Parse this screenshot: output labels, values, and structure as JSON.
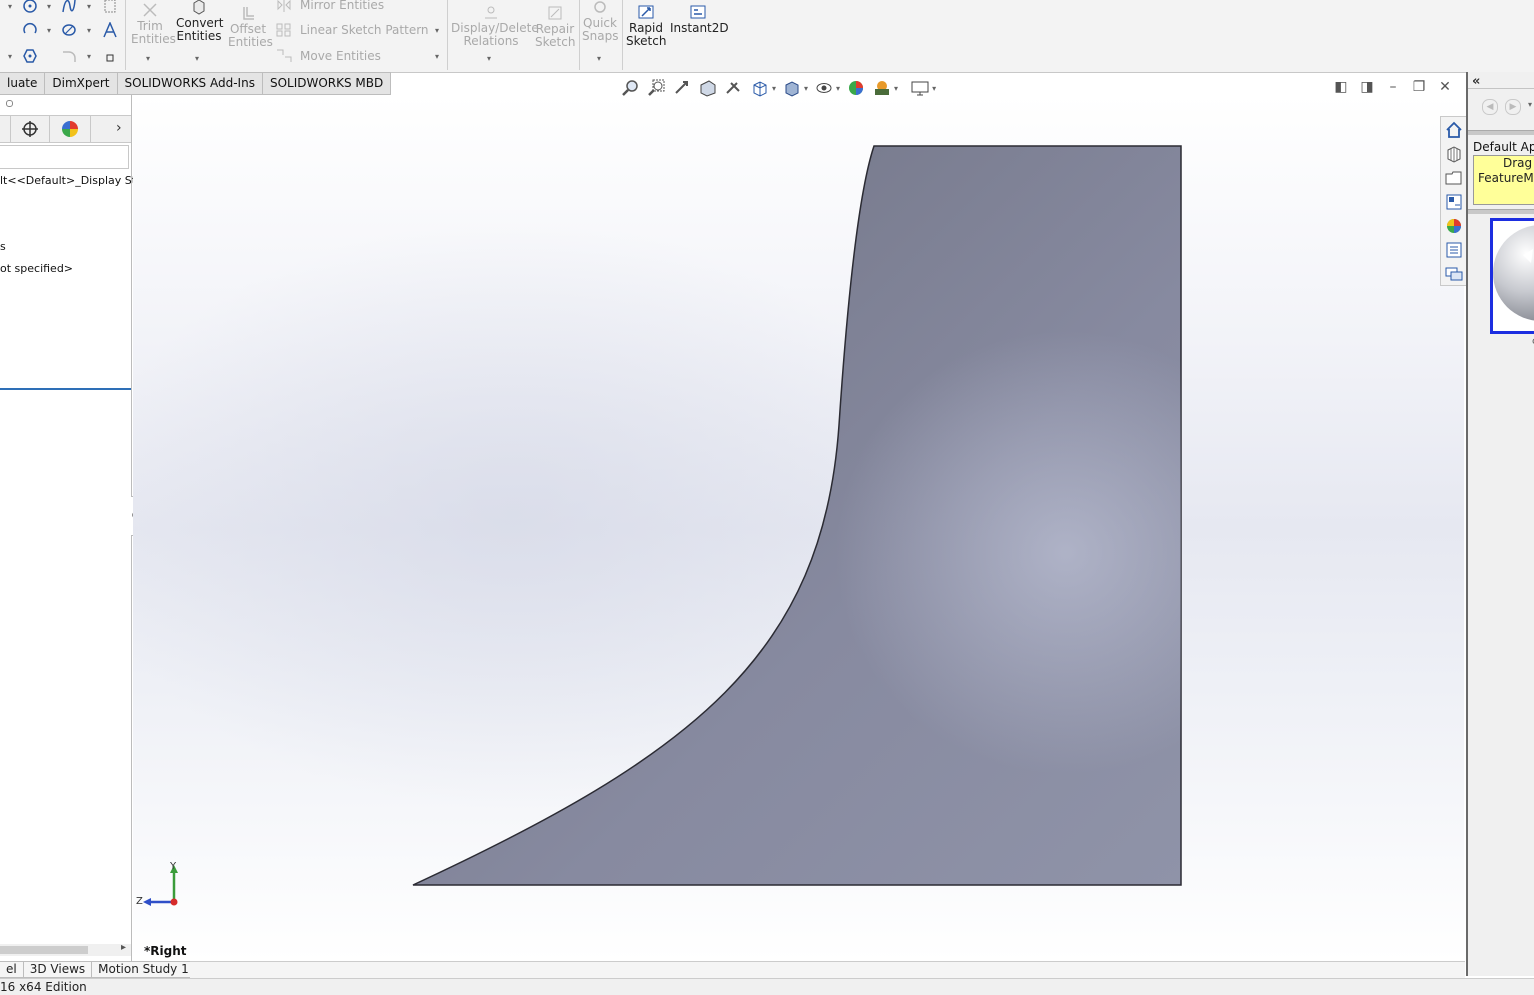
{
  "ribbon": {
    "trim": [
      "Trim",
      "Entities"
    ],
    "convert": [
      "Convert",
      "Entities"
    ],
    "offset": [
      "Offset",
      "Entities"
    ],
    "mirror": "Mirror Entities",
    "linear_pattern": "Linear Sketch Pattern",
    "move": "Move Entities",
    "display_delete": [
      "Display/Delete",
      "Relations"
    ],
    "repair": [
      "Repair",
      "Sketch"
    ],
    "quick_snaps": [
      "Quick",
      "Snaps"
    ],
    "rapid_sketch": [
      "Rapid",
      "Sketch"
    ],
    "instant2d": "Instant2D"
  },
  "command_tabs": [
    "luate",
    "DimXpert",
    "SOLIDWORKS Add-Ins",
    "SOLIDWORKS MBD"
  ],
  "left_panel": {
    "tree_lines": [
      "lt<<Default>_Display Sta",
      "s",
      "ot specified>"
    ]
  },
  "viewport": {
    "view_label": "*Right",
    "triad": {
      "y": "Y",
      "z": "Z"
    },
    "part_fill": "#7e8294"
  },
  "bottom_tabs": [
    "el",
    "3D Views",
    "Motion Study 1"
  ],
  "status_bar": "16 x64 Edition",
  "task_pane": {
    "title": "Default App",
    "hint_lines": [
      "Drag a",
      "FeatureMa"
    ]
  }
}
